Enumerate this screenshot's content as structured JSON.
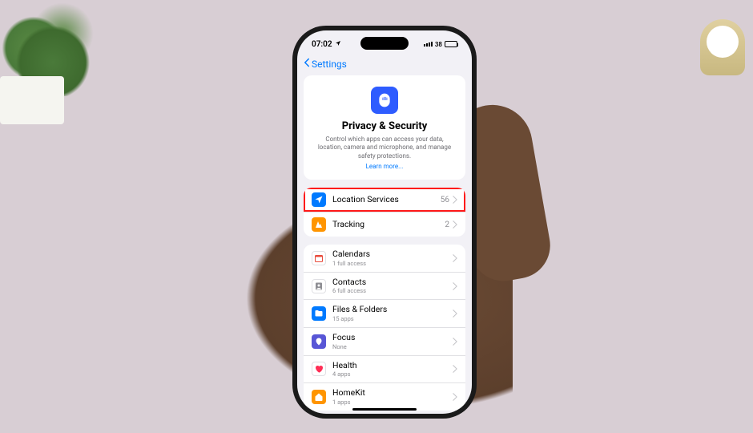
{
  "statusBar": {
    "time": "07:02",
    "batteryLabel": "38"
  },
  "nav": {
    "backLabel": "Settings"
  },
  "header": {
    "title": "Privacy & Security",
    "description": "Control which apps can access your data, location, camera and microphone, and manage safety protections.",
    "link": "Learn more..."
  },
  "group1": [
    {
      "label": "Location Services",
      "value": "56",
      "iconBg": "#007aff",
      "highlight": true,
      "iconKey": "location"
    },
    {
      "label": "Tracking",
      "value": "2",
      "iconBg": "#ff9500",
      "iconKey": "tracking"
    }
  ],
  "group2": [
    {
      "label": "Calendars",
      "sub": "1 full access",
      "iconBg": "#ffffff",
      "iconKey": "calendar"
    },
    {
      "label": "Contacts",
      "sub": "6 full access",
      "iconBg": "#ffffff",
      "iconKey": "contacts"
    },
    {
      "label": "Files & Folders",
      "sub": "15 apps",
      "iconBg": "#007aff",
      "iconKey": "files"
    },
    {
      "label": "Focus",
      "sub": "None",
      "iconBg": "#5856d6",
      "iconKey": "focus"
    },
    {
      "label": "Health",
      "sub": "4 apps",
      "iconBg": "#ffffff",
      "iconKey": "health"
    },
    {
      "label": "HomeKit",
      "sub": "1 apps",
      "iconBg": "#ff9500",
      "iconKey": "home"
    }
  ]
}
